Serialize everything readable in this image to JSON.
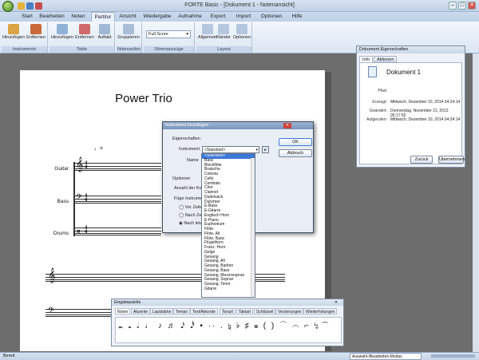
{
  "window": {
    "title": "FORTE Basic - [Dokument 1 - Notenansicht]",
    "min": "–",
    "max": "□",
    "close": "✕"
  },
  "tabs": [
    "Start",
    "Bearbeiten",
    "Noten",
    "Partitur",
    "Ansicht",
    "Wiedergabe",
    "Aufnahme",
    "Export",
    "Import",
    "Optionen",
    "Hilfe"
  ],
  "active_tab": "Partitur",
  "ribbon": {
    "instrumente": {
      "label": "Instrumente",
      "buttons": [
        "Hinzufügen",
        "Entfernen"
      ]
    },
    "takte": {
      "label": "Takte",
      "buttons": [
        "Hinzufügen",
        "Entfernen",
        "Auftakt"
      ]
    },
    "notenzeilen": {
      "label": "Notenzeilen",
      "buttons": [
        "Gruppieren"
      ]
    },
    "stimmauszuege": {
      "label": "Stimmauszüge",
      "select": "Full Score"
    },
    "layout": {
      "label": "Layout",
      "buttons": [
        "Allgemein",
        "Ränder",
        "Optionen"
      ]
    }
  },
  "score": {
    "title": "Power Trio",
    "tempo": "♩=",
    "instruments": [
      "Guitar",
      "Bass",
      "Drums"
    ]
  },
  "properties": {
    "title": "Dokument Eigenschaften",
    "tabs": [
      "Info",
      "Aktionen"
    ],
    "doc_name": "Dokument 1",
    "rows": [
      {
        "label": "Pfad:",
        "value": ""
      },
      {
        "label": "Erzeugt:",
        "value": "Mittwoch, Dezember 10, 2014 04:24:14"
      },
      {
        "label": "Geändert:",
        "value": "Donnerstag, November 21, 2013 05:17:50"
      },
      {
        "label": "Aufgerufen:",
        "value": "Mittwoch, Dezember 10, 2014 04:24:14"
      }
    ],
    "btn_back": "Zurück",
    "btn_apply": "Übernehmen"
  },
  "add_instrument": {
    "title": "Instrument hinzufügen",
    "section": "Eigenschaften",
    "instrument_label": "Instrument",
    "instrument_value": "<Standard>",
    "name_label": "Name",
    "options_label": "Optionen",
    "count_label": "Anzahl der Kop",
    "insert_label": "Füge Instrumen",
    "radio": [
      "Vor Zeile",
      "Nach Ze",
      "Nach letz"
    ],
    "ok": "OK",
    "cancel": "Abbruch",
    "list": [
      "<Standard>",
      "Bass",
      "Blockflöte",
      "Bratsche",
      "Celesta",
      "Cello",
      "Cembalo",
      "Chor",
      "Clarinet",
      "Dudelsack",
      "Dulcimer",
      "E-Bass",
      "E-Gitarre",
      "Englisch Horn",
      "E-Piano",
      "Euphonium",
      "Flöte",
      "Flöte, Alt",
      "Flöte, Bass",
      "Flügelhorn",
      "Franz. Horn",
      "Geige",
      "Gesang",
      "Gesang, Alt",
      "Gesang, Bariton",
      "Gesang, Bass",
      "Gesang, Mezzosopran",
      "Gesang, Sopran",
      "Gesang, Tenor",
      "Gitarre"
    ]
  },
  "palette": {
    "title": "Eingabepalette",
    "tabs": [
      "Noten",
      "Akzente",
      "Lautstärke",
      "Tempo",
      "Text/Akkorde",
      "Tonart",
      "Taktart",
      "Schlüssel",
      "Verzierungen",
      "Wiederholungen"
    ],
    "glyphs": "𝅜 𝅝 𝅗𝅥 ♩ ♪ ♬ 𝅘𝅥𝅯 𝅘𝅥𝅰   • ·· .   ♮ ♭ ♯ 𝄪 ( ) ⁀ ⌒  ⌐ ↯ ͡"
  },
  "status": {
    "left": "Bereit",
    "mode": "Auswahl-/Bearbeiten-Modus"
  }
}
